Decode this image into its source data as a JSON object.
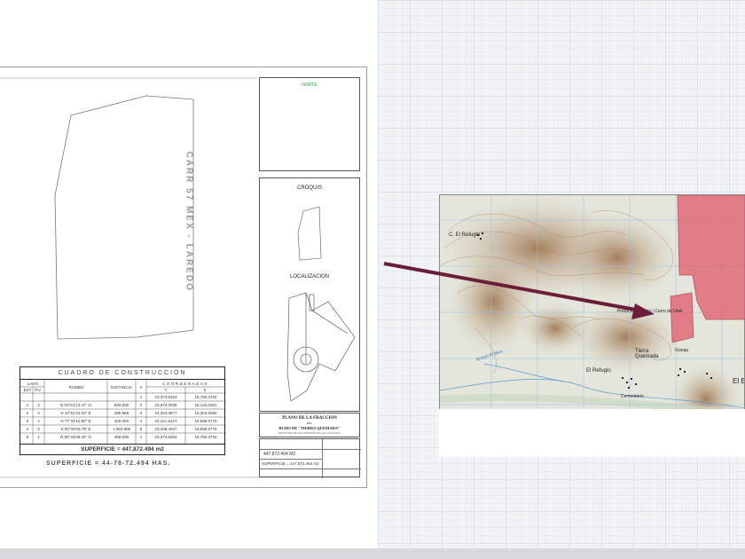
{
  "plan": {
    "road_label": "CARR 57 MEX - LAREDO",
    "north_label": "NORTE",
    "croquis_label": "CROQUIS",
    "localizacion_label": "LOCALIZACION",
    "title_block": {
      "line1": "PLANO DE LA FRACCION",
      "line2": "DEL",
      "line3": "RCHO DE \"TIERRA QUEMADA\"",
      "line4": "MUNICIPIO DE SAN ANTONIO DE LAS ALAZANAS"
    },
    "info_block": {
      "area_value": "447,872.494 M2",
      "superficie": "SUPERFICIE = 447,872.494 m2"
    },
    "table": {
      "title": "CUADRO DE CONSTRUCCION",
      "headers": {
        "lado": "LADO",
        "est": "EST",
        "pv": "P.V.",
        "rumbo": "RUMBO",
        "distancia": "DISTANCIA",
        "v": "V",
        "coordenadas": "COORDENADAS",
        "y": "Y",
        "x": "X"
      },
      "rows": [
        {
          "est": "",
          "pv": "",
          "rumbo": "",
          "dist": "",
          "v": "1",
          "y": "23,374.0263",
          "x": "18,750.3734"
        },
        {
          "est": "1",
          "pv": "2",
          "rumbo": "N 00°51'13.47\" O",
          "dist": "600.000",
          "v": "2",
          "y": "23,974.0036",
          "x": "18,144.0261"
        },
        {
          "est": "2",
          "pv": "3",
          "rumbo": "N 10°51'23.34\" E",
          "dist": "385.868",
          "v": "3",
          "y": "24,324.3877",
          "x": "18,304.0050"
        },
        {
          "est": "3",
          "pv": "4",
          "rumbo": "N 77°24'16.80\" E",
          "dist": "400.000",
          "v": "4",
          "y": "24,421.9127",
          "x": "18,598.9778"
        },
        {
          "est": "4",
          "pv": "5",
          "rumbo": "S 00°00'00.79\" E",
          "dist": "1,083.908",
          "v": "5",
          "y": "23,338.4047",
          "x": "18,598.9778"
        },
        {
          "est": "5",
          "pv": "1",
          "rumbo": "N 85°26'06.20\" O",
          "dist": "456.000",
          "v": "1",
          "y": "23,374.0263",
          "x": "18,750.3734"
        }
      ],
      "total": "SUPERFICIE = 447,872.494 m2"
    },
    "has_label": "SUPERFICIE = 44-78-72.494 HAS."
  },
  "map": {
    "labels": {
      "refugio_top": "C. El Refugio",
      "refugio": "El Refugio",
      "tierra_quemada": "Tierra Quemada",
      "cementerio": "Cementerio",
      "presa": "Presa de Materia / Cerro de Uriel",
      "arroyo": "Arroyo El Mon",
      "granja": "Granja",
      "right_edge": "El E"
    }
  },
  "colors": {
    "arrow": "#6b1d3a",
    "parcel": "#e05a6a",
    "contour": "#a8794f",
    "north_green": "#2fa24a"
  }
}
